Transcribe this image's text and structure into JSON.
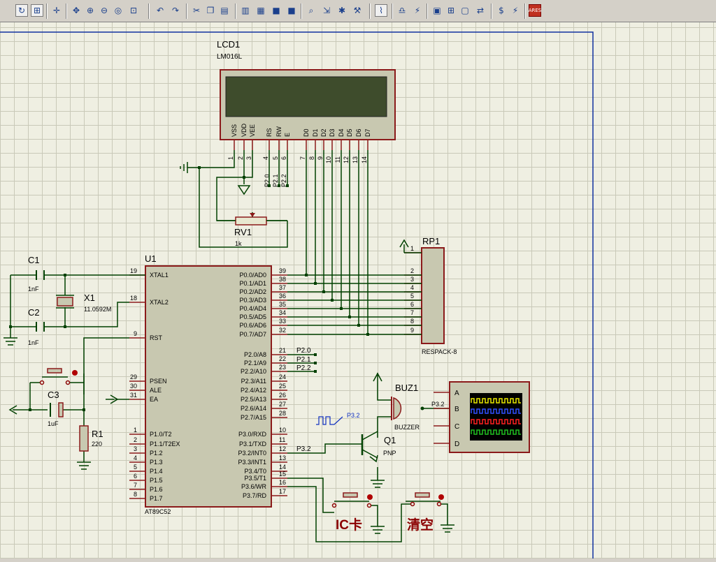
{
  "toolbar": {
    "icons": [
      "refresh-icon",
      "grid-icon",
      "origin-icon",
      "pan-icon",
      "zoom-in-icon",
      "zoom-out-icon",
      "zoom-all-icon",
      "zoom-area-icon",
      "undo-icon",
      "redo-icon",
      "cut-icon",
      "copy-icon",
      "paste-icon",
      "block-copy-icon",
      "block-move-icon",
      "block-rotate-icon",
      "block-delete-icon",
      "pick-device-icon",
      "make-device-icon",
      "decompose-icon",
      "package-tool-icon",
      "wire-autoroute-icon",
      "search-tag-icon",
      "property-tool-icon",
      "new-sheet-icon",
      "remove-sheet-icon",
      "goto-sheet-icon",
      "export-icon",
      "bom-icon",
      "electrical-check-icon"
    ],
    "ares_label": "ARES"
  },
  "lcd": {
    "ref": "LCD1",
    "model": "LM016L",
    "pin_names": [
      "VSS",
      "VDD",
      "VEE",
      "RS",
      "RW",
      "E",
      "D0",
      "D1",
      "D2",
      "D3",
      "D4",
      "D5",
      "D6",
      "D7"
    ],
    "pin_numbers": [
      "1",
      "2",
      "3",
      "4",
      "5",
      "6",
      "7",
      "8",
      "9",
      "10",
      "11",
      "12",
      "13",
      "14"
    ],
    "control_labels": [
      "P2.0",
      "P2.1",
      "P2.2"
    ]
  },
  "rv1": {
    "ref": "RV1",
    "value": "1k"
  },
  "rp1": {
    "ref": "RP1",
    "model": "RESPACK-8",
    "pins": [
      "1",
      "2",
      "3",
      "4",
      "5",
      "6",
      "7",
      "8",
      "9"
    ]
  },
  "mcu": {
    "ref": "U1",
    "model": "AT89C52",
    "left_pins": [
      {
        "num": "19",
        "name": "XTAL1"
      },
      {
        "num": "18",
        "name": "XTAL2"
      },
      {
        "num": "9",
        "name": "RST"
      },
      {
        "num": "29",
        "name": "PSEN"
      },
      {
        "num": "30",
        "name": "ALE"
      },
      {
        "num": "31",
        "name": "EA"
      },
      {
        "num": "1",
        "name": "P1.0/T2"
      },
      {
        "num": "2",
        "name": "P1.1/T2EX"
      },
      {
        "num": "3",
        "name": "P1.2"
      },
      {
        "num": "4",
        "name": "P1.3"
      },
      {
        "num": "5",
        "name": "P1.4"
      },
      {
        "num": "6",
        "name": "P1.5"
      },
      {
        "num": "7",
        "name": "P1.6"
      },
      {
        "num": "8",
        "name": "P1.7"
      }
    ],
    "right_pins": [
      {
        "num": "39",
        "name": "P0.0/AD0"
      },
      {
        "num": "38",
        "name": "P0.1/AD1"
      },
      {
        "num": "37",
        "name": "P0.2/AD2"
      },
      {
        "num": "36",
        "name": "P0.3/AD3"
      },
      {
        "num": "35",
        "name": "P0.4/AD4"
      },
      {
        "num": "34",
        "name": "P0.5/AD5"
      },
      {
        "num": "33",
        "name": "P0.6/AD6"
      },
      {
        "num": "32",
        "name": "P0.7/AD7"
      },
      {
        "num": "21",
        "name": "P2.0/A8"
      },
      {
        "num": "22",
        "name": "P2.1/A9"
      },
      {
        "num": "23",
        "name": "P2.2/A10"
      },
      {
        "num": "24",
        "name": "P2.3/A11"
      },
      {
        "num": "25",
        "name": "P2.4/A12"
      },
      {
        "num": "26",
        "name": "P2.5/A13"
      },
      {
        "num": "27",
        "name": "P2.6/A14"
      },
      {
        "num": "28",
        "name": "P2.7/A15"
      },
      {
        "num": "10",
        "name": "P3.0/RXD"
      },
      {
        "num": "11",
        "name": "P3.1/TXD"
      },
      {
        "num": "12",
        "name": "P3.2/INT0"
      },
      {
        "num": "13",
        "name": "P3.3/INT1"
      },
      {
        "num": "14",
        "name": "P3.4/T0"
      },
      {
        "num": "15",
        "name": "P3.5/T1"
      },
      {
        "num": "16",
        "name": "P3.6/WR"
      },
      {
        "num": "17",
        "name": "P3.7/RD"
      }
    ],
    "p2_labels": [
      "P2.0",
      "P2.1",
      "P2.2"
    ]
  },
  "c1": {
    "ref": "C1",
    "value": "1nF"
  },
  "c2": {
    "ref": "C2",
    "value": "1nF"
  },
  "c3": {
    "ref": "C3",
    "value": "1uF"
  },
  "x1": {
    "ref": "X1",
    "value": "11.0592M"
  },
  "r1": {
    "ref": "R1",
    "value": "220"
  },
  "buz1": {
    "ref": "BUZ1",
    "model": "BUZZER"
  },
  "q1": {
    "ref": "Q1",
    "model": "PNP"
  },
  "scope": {
    "channels": [
      "A",
      "B",
      "C",
      "D"
    ],
    "trace_colors": [
      "#e8e800",
      "#3050ff",
      "#ff2020",
      "#20c020"
    ]
  },
  "net_labels": {
    "p32_a": "P3.2",
    "p32_b": "P3.2",
    "p32_c": "P3.2"
  },
  "buttons": {
    "ic_label": "IC卡",
    "clear_label": "清空"
  }
}
